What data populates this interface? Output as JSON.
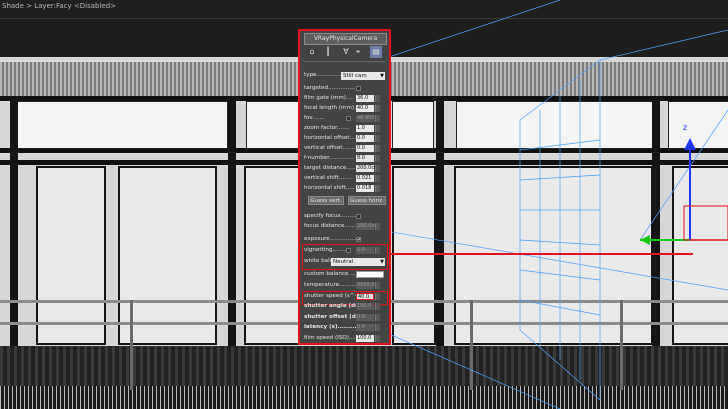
{
  "window": {
    "title_strip": "Shade > Layer:Facy <Disabled>"
  },
  "panel": {
    "title": "VRayPhysicalCamera",
    "toolbar": [
      "pin-icon",
      "hammer-icon",
      "funnel-icon",
      "display-icon",
      "configure-icon"
    ],
    "type": {
      "label": "type..............",
      "value": "Still cam"
    },
    "targeted": {
      "label": "targeted..............."
    },
    "film_gate": {
      "label": "film gate (mm)....",
      "value": "36.0"
    },
    "focal_length": {
      "label": "focal length (mm)..",
      "value": "40.0"
    },
    "fov": {
      "label": "fov.......",
      "value": "48.455"
    },
    "zoom_factor": {
      "label": "zoom factor.......",
      "value": "1.0"
    },
    "horizontal_offset": {
      "label": "horizontal offset....",
      "value": "0.0"
    },
    "vertical_offset": {
      "label": "vertical offset.......",
      "value": "0.0"
    },
    "fnumber": {
      "label": "f-number..............",
      "value": "8.0"
    },
    "target_distance": {
      "label": "target distance.....",
      "value": "200.0cr"
    },
    "vertical_shift": {
      "label": "vertical shift.......",
      "value": "0.021"
    },
    "horizontal_shift": {
      "label": "horizontal shift.....",
      "value": "0.018"
    },
    "guess_vert": "Guess vert.",
    "guess_horiz": "Guess horiz.",
    "specify_focus": {
      "label": "specify focus.........."
    },
    "focus_distance": {
      "label": "focus distance......",
      "value": "200.0cm"
    },
    "exposure": {
      "label": "exposure................",
      "checked": true
    },
    "vignetting": {
      "label": "vignetting..........",
      "value": "1.0"
    },
    "white_balance": {
      "label": "white balance",
      "value": "Neutral"
    },
    "custom_balance": {
      "label": "custom balance ..."
    },
    "temperature": {
      "label": "temperature..........",
      "value": "6500.0"
    },
    "shutter_speed": {
      "label": "shutter speed (s^-1)",
      "value": "40.0"
    },
    "shutter_angle": {
      "label": "shutter angle (deg)",
      "value": "180.0"
    },
    "shutter_offset": {
      "label": "shutter offset (deg)",
      "value": "0.0"
    },
    "latency": {
      "label": "latency (s)............",
      "value": "0.0"
    },
    "film_speed": {
      "label": "film speed (ISO).....",
      "value": "100.0"
    }
  },
  "viewport": {
    "gizmo_axis": "z",
    "accent_color": "#e0141c"
  }
}
